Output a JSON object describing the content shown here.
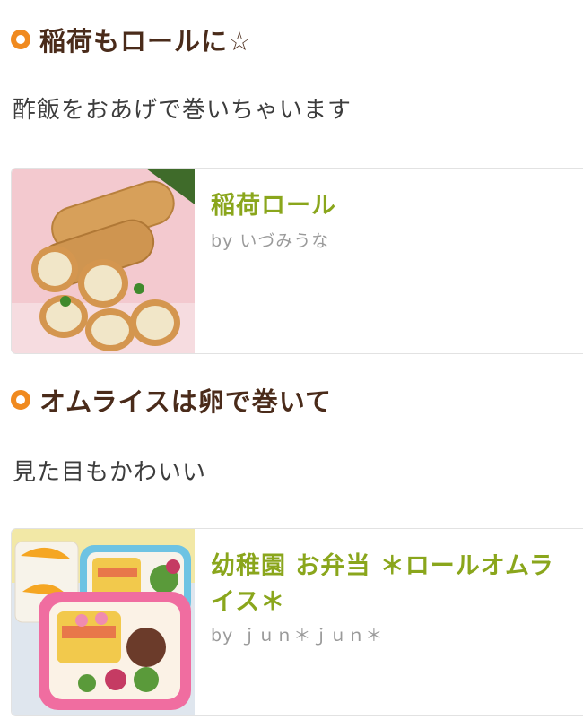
{
  "sections": [
    {
      "heading": "稲荷もロールに☆",
      "description": "酢飯をおあげで巻いちゃいます",
      "recipe": {
        "title": "稲荷ロール",
        "author": "by いづみうな",
        "image_icon": "inari-roll-photo"
      }
    },
    {
      "heading": "オムライスは卵で巻いて",
      "description": "見た目もかわいい",
      "recipe": {
        "title": "幼稚園 お弁当 ＊ロールオムライス＊",
        "author": "by ｊｕｎ＊ｊｕｎ＊",
        "image_icon": "bento-box-photo"
      }
    }
  ],
  "colors": {
    "accent": "#f08a1f",
    "heading": "#4a2b1a",
    "recipe_title": "#8aa61c",
    "author": "#9a9a9a"
  }
}
